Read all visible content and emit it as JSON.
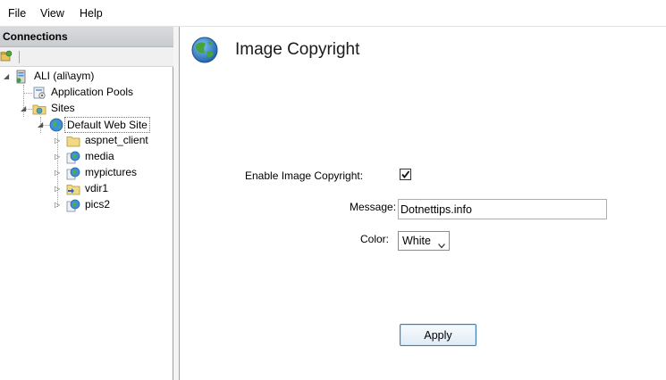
{
  "menu": {
    "file": "File",
    "view": "View",
    "help": "Help"
  },
  "connections": {
    "title": "Connections",
    "tree": {
      "server": "ALI (ali\\aym)",
      "app_pools": "Application Pools",
      "sites": "Sites",
      "default_site": "Default Web Site",
      "children": [
        "aspnet_client",
        "media",
        "mypictures",
        "vdir1",
        "pics2"
      ]
    }
  },
  "feature": {
    "title": "Image Copyright",
    "enable_label": "Enable Image Copyright:",
    "enable_checked": true,
    "message_label": "Message:",
    "message_value": "Dotnettips.info",
    "color_label": "Color:",
    "color_value": "White",
    "apply_label": "Apply"
  }
}
